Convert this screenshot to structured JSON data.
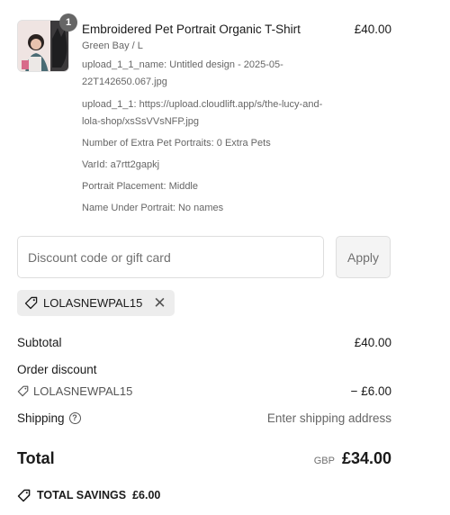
{
  "product": {
    "quantity": "1",
    "title": "Embroidered Pet Portrait Organic T-Shirt",
    "price": "£40.00",
    "lines": [
      "Green Bay / L",
      "upload_1_1_name: Untitled design - 2025-05-",
      "22T142650.067.jpg",
      "upload_1_1: https://upload.cloudlift.app/s/the-lucy-and-",
      "lola-shop/xsSsVVsNFP.jpg",
      "Number of Extra Pet Portraits: 0 Extra Pets",
      "VarId: a7rtt2gapkj",
      "Portrait Placement: Middle",
      "Name Under Portrait: No names"
    ]
  },
  "discount": {
    "placeholder": "Discount code or gift card",
    "apply_label": "Apply",
    "applied_code": "LOLASNEWPAL15"
  },
  "summary": {
    "subtotal_label": "Subtotal",
    "subtotal_value": "£40.00",
    "order_discount_label": "Order discount",
    "discount_code": "LOLASNEWPAL15",
    "discount_value": "− £6.00",
    "shipping_label": "Shipping",
    "shipping_value": "Enter shipping address",
    "total_label": "Total",
    "currency": "GBP",
    "total_value": "£34.00",
    "savings_label": "TOTAL SAVINGS",
    "savings_value": "£6.00"
  }
}
